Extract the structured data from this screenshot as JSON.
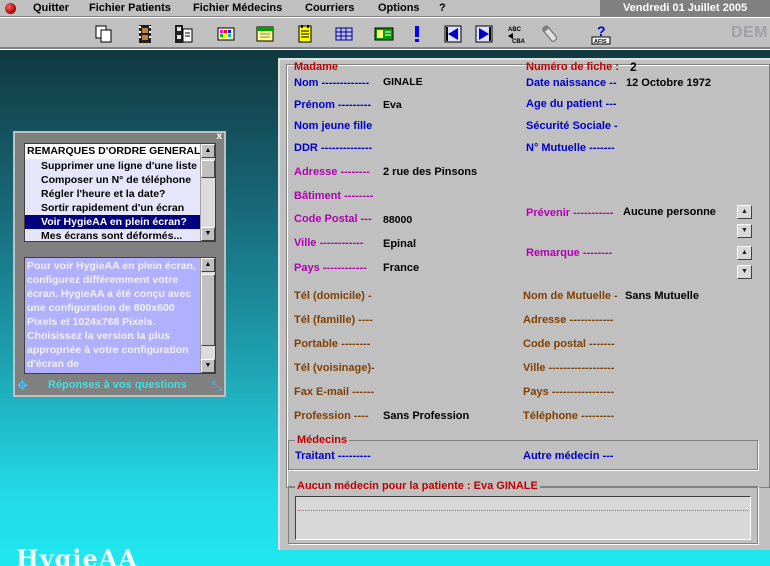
{
  "menubar": {
    "items": [
      "Quitter",
      "Fichier Patients",
      "Fichier Médecins",
      "Courriers",
      "Options",
      "?"
    ],
    "date": "Vendredi 01 Juillet 2005"
  },
  "toolbar": {
    "icons": [
      "copy-icon",
      "film-icon",
      "document-film-icon",
      "palette-icon",
      "calendar-icon",
      "notepad-icon",
      "grid-icon",
      "card-icon",
      "exclamation-icon",
      "arrow-left-icon",
      "arrow-right-icon",
      "abc-swap-icon",
      "tube-icon",
      "help-icon"
    ],
    "abc_label": "ABC",
    "cba_label": "CBA",
    "help_caption": "AFIS",
    "dem": "DEM"
  },
  "help_panel": {
    "close": "x",
    "list_header": "REMARQUES D'ORDRE GENERAL",
    "items": [
      "Supprimer une ligne d'une liste",
      "Composer un N° de téléphone",
      "Régler l'heure et la date?",
      "Sortir rapidement d'un écran",
      "Voir HygieAA en plein écran?",
      "Mes écrans sont déformés..."
    ],
    "description": "Pour voir HygieAA en plein écran, configurez différemment votre écran. HygieAA a été conçu avec une configuration de 800x600 Pixels et 1024x768 Pixels. Choisissez la version la plus appropriée à votre configuration d'écran de",
    "footer": "Réponses à vos questions"
  },
  "logo": "HygieAA",
  "form": {
    "civilite": "Madame",
    "num_fiche_label": "Numéro de fiche :",
    "num_fiche": "2",
    "nom_label": "Nom -------------",
    "nom": "GINALE",
    "date_naissance_label": "Date naissance --",
    "date_naissance": "12  Octobre  1972",
    "prenom_label": "Prénom ---------",
    "prenom": "Eva",
    "age_label": "Age du patient ---",
    "nom_jeune_fille_label": "Nom jeune fille",
    "secu_label": "Sécurité Sociale -",
    "ddr_label": "DDR --------------",
    "mutuelle_num_label": "N° Mutuelle -------",
    "adresse_label": "Adresse --------",
    "adresse": "2 rue des Pinsons",
    "batiment_label": "Bâtiment --------",
    "code_postal_label": "Code Postal ---",
    "code_postal": "88000",
    "prevenir_label": "Prévenir -----------",
    "prevenir": "Aucune personne",
    "ville_label": "Ville ------------",
    "ville": "Epinal",
    "remarque_label": "Remarque --------",
    "pays_label": "Pays ------------",
    "pays": "France",
    "tel_domicile_label": "Tél (domicile) -",
    "nom_mutuelle_label": "Nom de Mutuelle -",
    "nom_mutuelle": "Sans Mutuelle",
    "tel_famille_label": "Tél (famille) ----",
    "mut_adresse_label": "Adresse ------------",
    "portable_label": "Portable --------",
    "mut_code_postal_label": "Code postal -------",
    "tel_voisinage_label": "Tél (voisinage)-",
    "mut_ville_label": "Ville ------------------",
    "fax_label": "Fax E-mail ------",
    "mut_pays_label": "Pays -----------------",
    "profession_label": "Profession ----",
    "profession": "Sans Profession",
    "mut_tel_label": "Téléphone ---------",
    "medecins_legend": "Médecins",
    "traitant_label": "Traitant ---------",
    "autre_medecin_label": "Autre médecin ---",
    "aucun_medecin": "Aucun médecin pour la patiente : Eva  GINALE"
  }
}
